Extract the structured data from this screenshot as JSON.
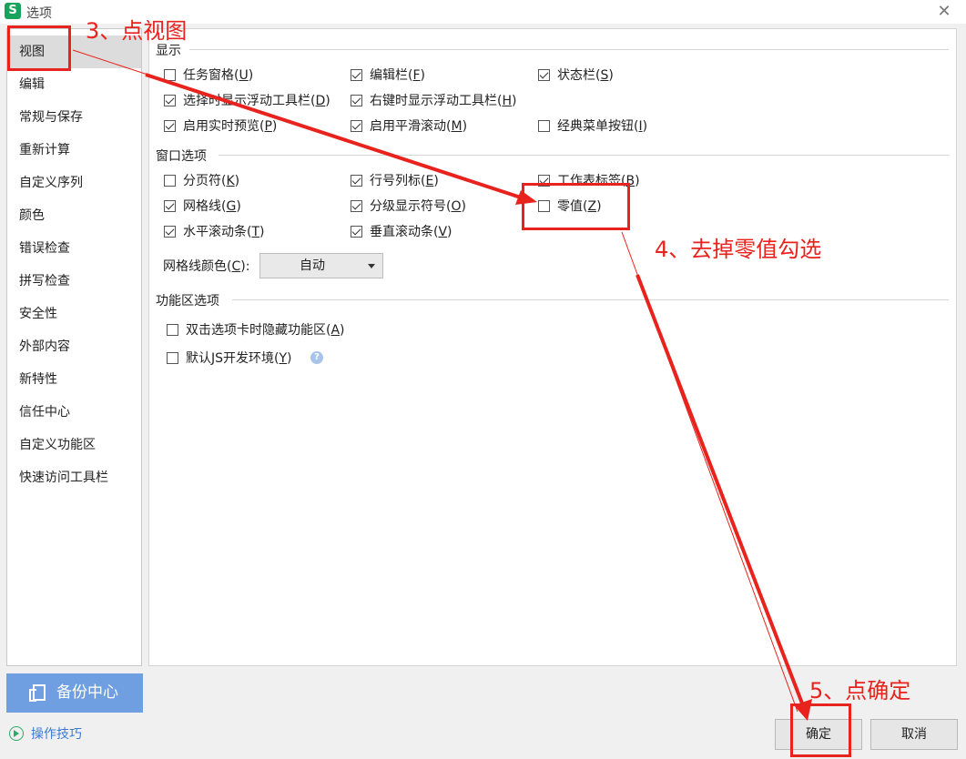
{
  "window": {
    "title": "选项",
    "app_icon_letter": "S",
    "close_glyph": "✕"
  },
  "sidebar": {
    "items": [
      {
        "label": "视图",
        "active": true
      },
      {
        "label": "编辑"
      },
      {
        "label": "常规与保存"
      },
      {
        "label": "重新计算"
      },
      {
        "label": "自定义序列"
      },
      {
        "label": "颜色"
      },
      {
        "label": "错误检查"
      },
      {
        "label": "拼写检查"
      },
      {
        "label": "安全性"
      },
      {
        "label": "外部内容"
      },
      {
        "label": "新特性"
      },
      {
        "label": "信任中心"
      },
      {
        "label": "自定义功能区"
      },
      {
        "label": "快速访问工具栏"
      }
    ],
    "backup_label": "备份中心",
    "tips_label": "操作技巧"
  },
  "display": {
    "title": "显示",
    "options": [
      {
        "label": "任务窗格",
        "key": "U",
        "checked": false
      },
      {
        "label": "编辑栏",
        "key": "F",
        "checked": true
      },
      {
        "label": "状态栏",
        "key": "S",
        "checked": true
      },
      {
        "label": "选择时显示浮动工具栏",
        "key": "D",
        "checked": true
      },
      {
        "label": "右键时显示浮动工具栏",
        "key": "H",
        "checked": true
      },
      {
        "label": "启用实时预览",
        "key": "P",
        "checked": true
      },
      {
        "label": "启用平滑滚动",
        "key": "M",
        "checked": true
      },
      {
        "label": "经典菜单按钮",
        "key": "I",
        "checked": false
      }
    ]
  },
  "window_options": {
    "title": "窗口选项",
    "options": [
      {
        "label": "分页符",
        "key": "K",
        "checked": false
      },
      {
        "label": "行号列标",
        "key": "E",
        "checked": true
      },
      {
        "label": "工作表标签",
        "key": "B",
        "checked": true
      },
      {
        "label": "网格线",
        "key": "G",
        "checked": true
      },
      {
        "label": "分级显示符号",
        "key": "O",
        "checked": true
      },
      {
        "label": "零值",
        "key": "Z",
        "checked": false
      },
      {
        "label": "水平滚动条",
        "key": "T",
        "checked": true
      },
      {
        "label": "垂直滚动条",
        "key": "V",
        "checked": true
      }
    ],
    "gridline_color_label": "网格线颜色(",
    "gridline_color_key": "C",
    "gridline_color_suffix": "):",
    "gridline_color_value": "自动"
  },
  "ribbon": {
    "title": "功能区选项",
    "options": [
      {
        "label": "双击选项卡时隐藏功能区",
        "key": "A",
        "checked": false
      },
      {
        "label": "默认JS开发环境",
        "key": "Y",
        "checked": false
      }
    ],
    "help_glyph": "?"
  },
  "buttons": {
    "ok": "确定",
    "cancel": "取消"
  },
  "annotations": {
    "step3": "3、点视图",
    "step4": "4、去掉零值勾选",
    "step5": "5、点确定",
    "color": "#e8231d"
  }
}
